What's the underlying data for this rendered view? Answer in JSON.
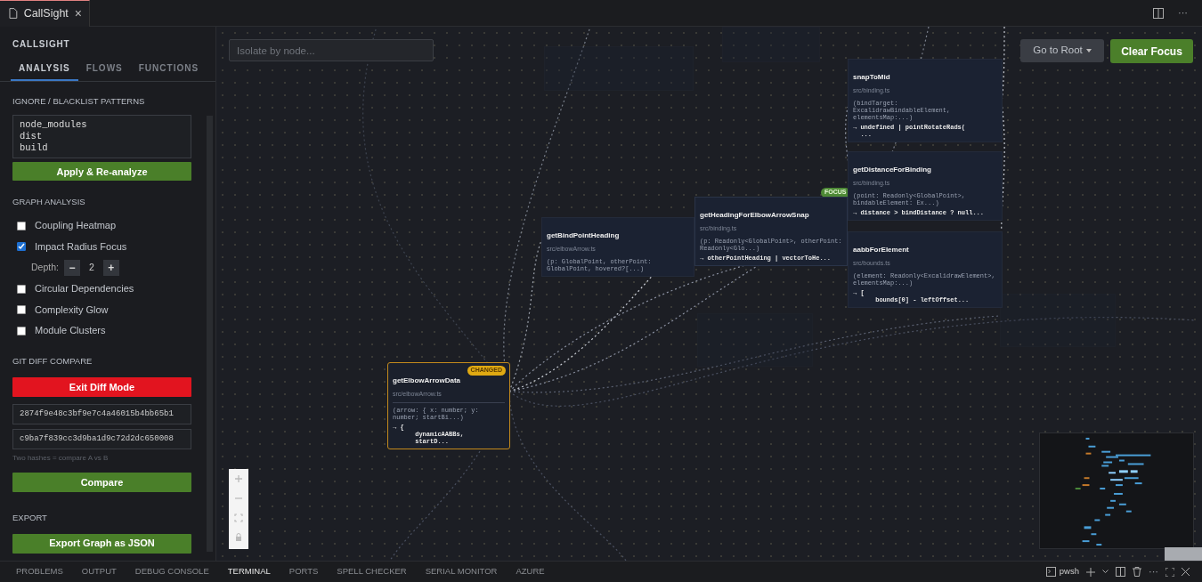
{
  "editor_tab": {
    "title": "CallSight",
    "close": "×"
  },
  "sidebar": {
    "title": "CALLSIGHT",
    "tabs": [
      {
        "label": "ANALYSIS",
        "selected": true
      },
      {
        "label": "FLOWS",
        "selected": false
      },
      {
        "label": "FUNCTIONS",
        "selected": false
      }
    ],
    "ignore": {
      "heading": "IGNORE / BLACKLIST PATTERNS",
      "value": "node_modules\ndist\nbuild",
      "button": "Apply & Re-analyze"
    },
    "graph_analysis": {
      "heading": "GRAPH ANALYSIS",
      "options": [
        {
          "label": "Coupling Heatmap",
          "checked": false
        },
        {
          "label": "Impact Radius Focus",
          "checked": true
        },
        {
          "label": "Circular Dependencies",
          "checked": false
        },
        {
          "label": "Complexity Glow",
          "checked": false
        },
        {
          "label": "Module Clusters",
          "checked": false
        }
      ],
      "depth": {
        "label": "Depth:",
        "minus": "−",
        "value": "2",
        "plus": "+"
      }
    },
    "git_diff": {
      "heading": "GIT DIFF COMPARE",
      "exit_button": "Exit Diff Mode",
      "hash_a": "2874f9e48c3bf9e7c4a46015b4bb65b1",
      "hash_b": "c9ba7f839cc3d9ba1d9c72d2dc650008",
      "hint": "Two hashes = compare A vs B",
      "compare_button": "Compare"
    },
    "export": {
      "heading": "EXPORT",
      "button": "Export Graph as JSON"
    }
  },
  "graph": {
    "search": {
      "placeholder": "Isolate by node..."
    },
    "root_button": "Go to Root",
    "clear_button": "Clear Focus",
    "nodes": [
      {
        "name": "getBindPointHeading",
        "file": "src/elbowArrow.ts",
        "signature": "(p: GlobalPoint, otherPoint: GlobalPoint, hovered?[...)",
        "kind": "normal"
      },
      {
        "name": "getHeadingForElbowArrowSnap",
        "file": "src/binding.ts",
        "signature": "(p: Readonly<GlobalPoint>, otherPoint: Readonly<Glo...)",
        "body": "→ otherPointHeading | vectorToHe...",
        "badge": "FOCUS",
        "kind": "focus"
      },
      {
        "name": "snapToMid",
        "file": "src/binding.ts",
        "signature": "(bindTarget: ExcalidrawBindableElement, elementsMap:...)",
        "body": "→ undefined | pointRotateRads(\n  ...",
        "kind": "normal"
      },
      {
        "name": "getDistanceForBinding",
        "file": "src/binding.ts",
        "signature": "(point: Readonly<GlobalPoint>, bindableElement: Ex...)",
        "body": "→ distance > bindDistance ? null...",
        "kind": "normal"
      },
      {
        "name": "aabbForElement",
        "file": "src/bounds.ts",
        "signature": "(element: Readonly<ExcalidrawElement>, elementsMap:...)",
        "body": "→ [\n      bounds[0] - leftOffset...",
        "kind": "normal"
      },
      {
        "name": "getElbowArrowData",
        "file": "src/elbowArrow.ts",
        "signature": "(arrow: { x: number; y: number; startBi...)",
        "body": "→ {\n      dynamicAABBs,\n      startD...",
        "badge": "CHANGED",
        "kind": "changed"
      }
    ]
  },
  "panel": {
    "tabs": [
      {
        "label": "PROBLEMS",
        "selected": false
      },
      {
        "label": "OUTPUT",
        "selected": false
      },
      {
        "label": "DEBUG CONSOLE",
        "selected": false
      },
      {
        "label": "TERMINAL",
        "selected": true
      },
      {
        "label": "PORTS",
        "selected": false
      },
      {
        "label": "SPELL CHECKER",
        "selected": false
      },
      {
        "label": "SERIAL MONITOR",
        "selected": false
      },
      {
        "label": "AZURE",
        "selected": false
      }
    ],
    "terminal": "pwsh",
    "more": "···"
  },
  "editor_more": "···"
}
